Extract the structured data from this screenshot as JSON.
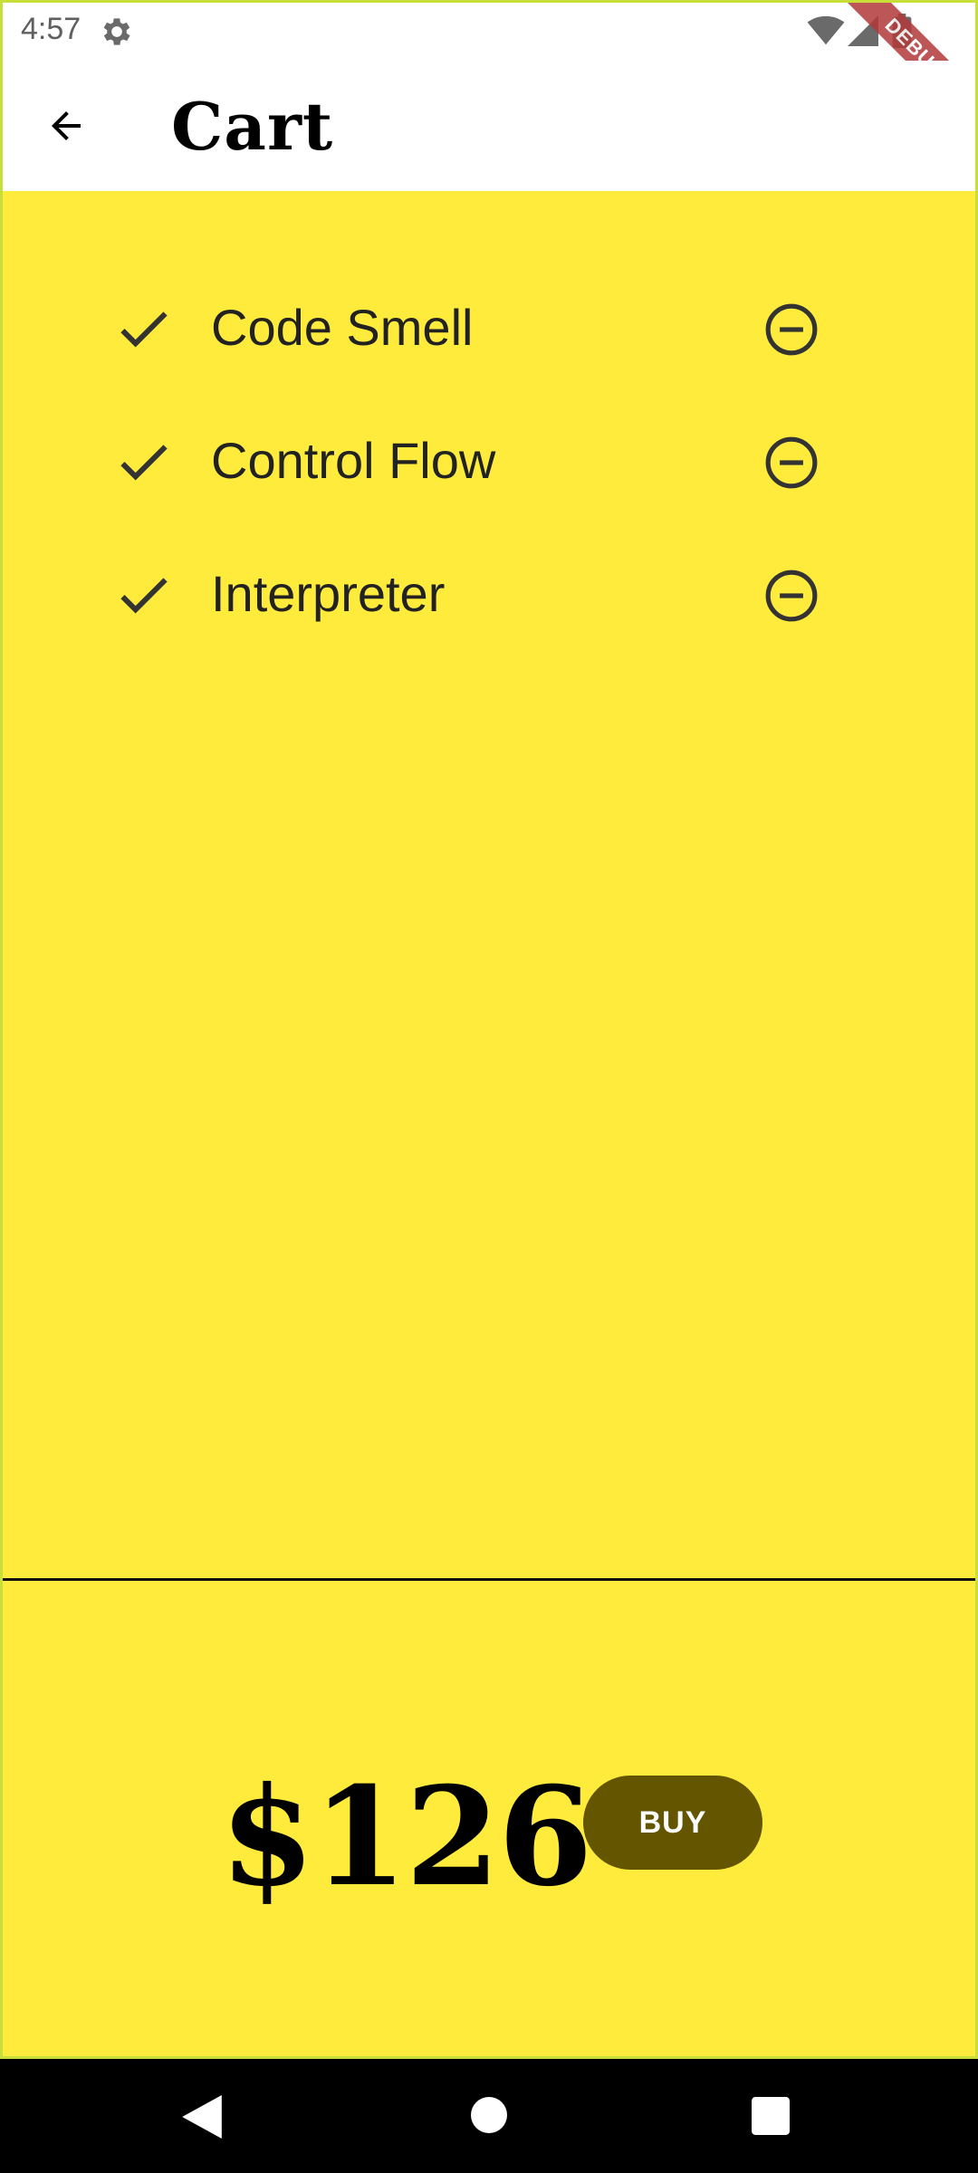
{
  "status_bar": {
    "time": "4:57"
  },
  "debug_banner": "DEBUG",
  "app_bar": {
    "title": "Cart"
  },
  "cart": {
    "items": [
      {
        "label": "Code Smell"
      },
      {
        "label": "Control Flow"
      },
      {
        "label": "Interpreter"
      }
    ]
  },
  "footer": {
    "total": "$126",
    "buy_label": "BUY"
  },
  "colors": {
    "background": "#ffeb3b",
    "buy_button": "#645600",
    "debug_ribbon": "#b23a3a"
  },
  "icons": {
    "status": [
      "gear-icon",
      "wifi-icon",
      "signal-icon",
      "battery-icon"
    ],
    "item": [
      "check-icon",
      "remove-circle-icon"
    ],
    "nav": [
      "nav-back-icon",
      "nav-home-icon",
      "nav-recents-icon"
    ]
  }
}
